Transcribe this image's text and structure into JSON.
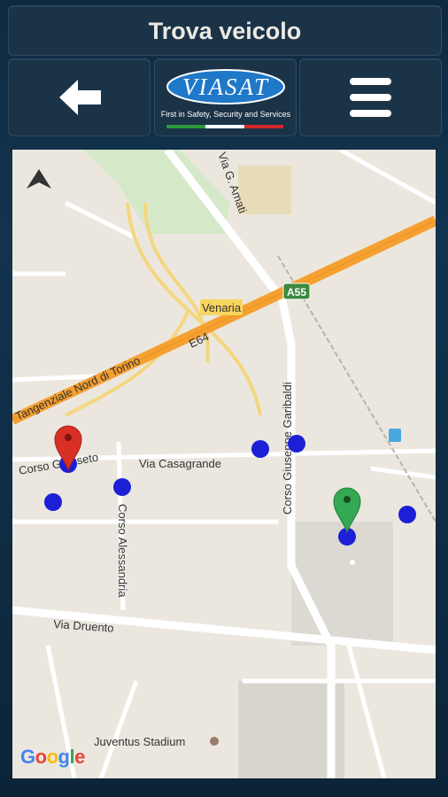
{
  "header": {
    "title": "Trova veicolo"
  },
  "toolbar": {
    "back_icon": "arrow-left-icon",
    "menu_icon": "hamburger-menu-icon",
    "logo": {
      "brand": "VIASAT",
      "tagline": "First in Safety, Security and Services"
    }
  },
  "map": {
    "streets": {
      "via_amati": "Via G. Amati",
      "venaria": "Venaria",
      "a55": "A55",
      "e64": "E64",
      "tangenziale": "Tangenziale Nord di Torino",
      "corso_grosseto": "Corso Grosseto",
      "via_casagrande": "Via Casagrande",
      "corso_garibaldi": "Corso Giuseppe Garibaldi",
      "corso_alessandria": "Corso Alessandria",
      "via_druento": "Via Druento",
      "juventus": "Juventus Stadium"
    },
    "attribution": "Google",
    "markers": {
      "red_pin": {
        "color": "#d93025"
      },
      "green_pin": {
        "color": "#34a853"
      },
      "blue_dot_color": "#1d1fd6"
    }
  },
  "colors": {
    "background": "#12344f",
    "tile": "#1b3347",
    "highway": "#f5a030",
    "map_bg": "#ebe7df"
  }
}
